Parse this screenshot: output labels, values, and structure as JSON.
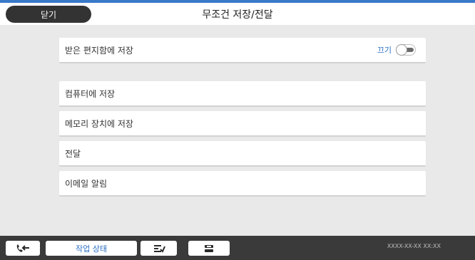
{
  "header": {
    "close_label": "닫기",
    "title": "무조건 저장/전달"
  },
  "settings": {
    "save_to_inbox": {
      "label": "받은 편지함에 저장",
      "state": "끄기",
      "enabled": false
    },
    "items": [
      {
        "label": "컴퓨터에 저장"
      },
      {
        "label": "메모리 장치에 저장"
      },
      {
        "label": "전달"
      },
      {
        "label": "이메일 알림"
      }
    ]
  },
  "footer": {
    "job_status_label": "작업 상태",
    "datetime": "XXXX-XX-XX XX:XX",
    "icons": [
      "fax-receive-icon",
      "hook-transmit-icon",
      "fax-icon"
    ]
  },
  "colors": {
    "accent": "#3a78c8",
    "toggle_text": "#2b6fc4",
    "header_button": "#333333",
    "footer_bg": "#3a3a3a"
  }
}
